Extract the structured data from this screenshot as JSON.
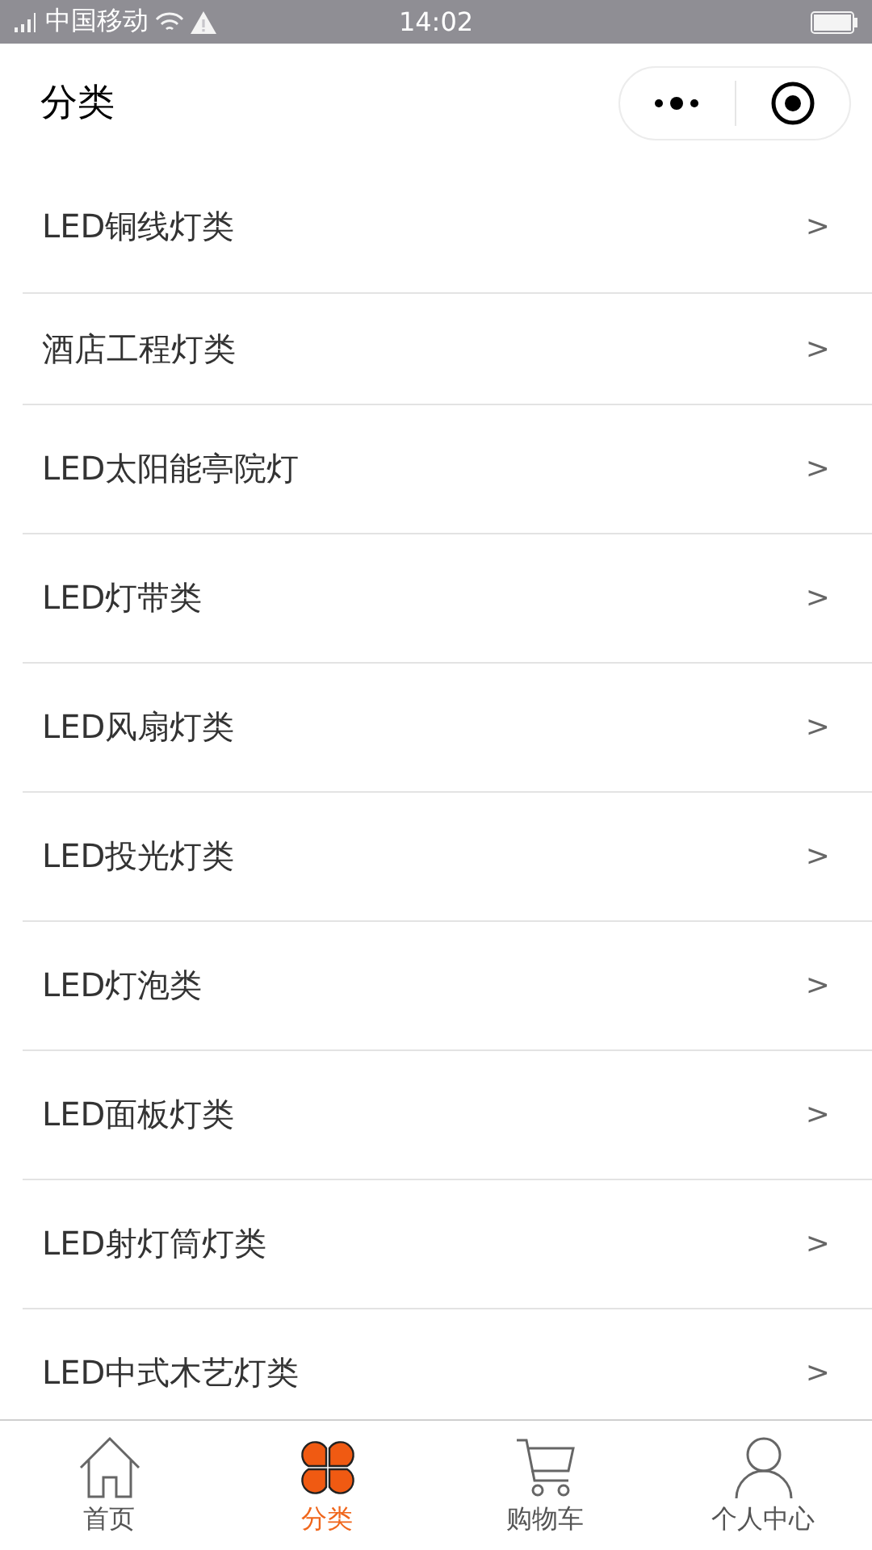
{
  "status_bar": {
    "carrier": "中国移动",
    "time": "14:02"
  },
  "header": {
    "title": "分类"
  },
  "categories": [
    {
      "name": "LED铜线灯类",
      "arrow": ">"
    },
    {
      "name": "酒店工程灯类",
      "arrow": ">"
    },
    {
      "name": "LED太阳能亭院灯",
      "arrow": ">"
    },
    {
      "name": "LED灯带类",
      "arrow": ">"
    },
    {
      "name": "LED风扇灯类",
      "arrow": ">"
    },
    {
      "name": "LED投光灯类",
      "arrow": ">"
    },
    {
      "name": "LED灯泡类",
      "arrow": ">"
    },
    {
      "name": "LED面板灯类",
      "arrow": ">"
    },
    {
      "name": "LED射灯筒灯类",
      "arrow": ">"
    },
    {
      "name": "LED中式木艺灯类",
      "arrow": ">"
    }
  ],
  "tab_bar": [
    {
      "kind": "home",
      "label": "首页",
      "selected": false
    },
    {
      "kind": "category",
      "label": "分类",
      "selected": true
    },
    {
      "kind": "cart",
      "label": "购物车",
      "selected": false
    },
    {
      "kind": "user",
      "label": "个人中心",
      "selected": false
    }
  ]
}
